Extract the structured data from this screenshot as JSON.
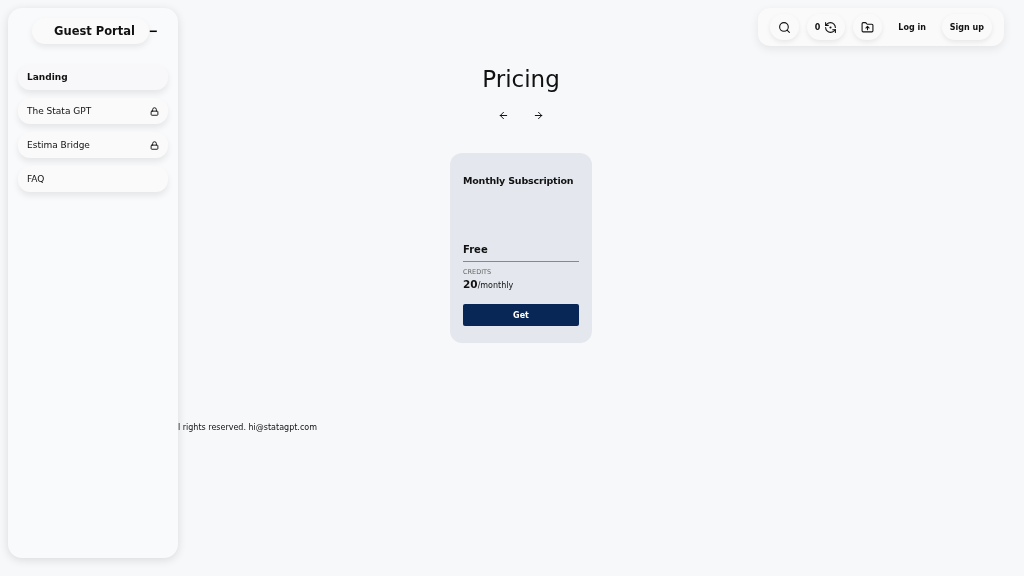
{
  "sidebar": {
    "title": "Guest Portal",
    "collapse_symbol": "−",
    "items": [
      {
        "label": "Landing",
        "selected": true,
        "locked": false
      },
      {
        "label": "The Stata GPT",
        "selected": false,
        "locked": true
      },
      {
        "label": "Estima Bridge",
        "selected": false,
        "locked": true
      },
      {
        "label": "FAQ",
        "selected": false,
        "locked": false
      }
    ]
  },
  "toolbar": {
    "credits": "0",
    "login": "Log in",
    "signup": "Sign up"
  },
  "page": {
    "title": "Pricing"
  },
  "plans": [
    {
      "name": "Monthly Subscription",
      "price": "Free",
      "credits_label": "CREDITS",
      "credits_value": "20",
      "credits_period": "/monthly",
      "button": "Get"
    }
  ],
  "footer": "l rights reserved. hi@statagpt.com"
}
